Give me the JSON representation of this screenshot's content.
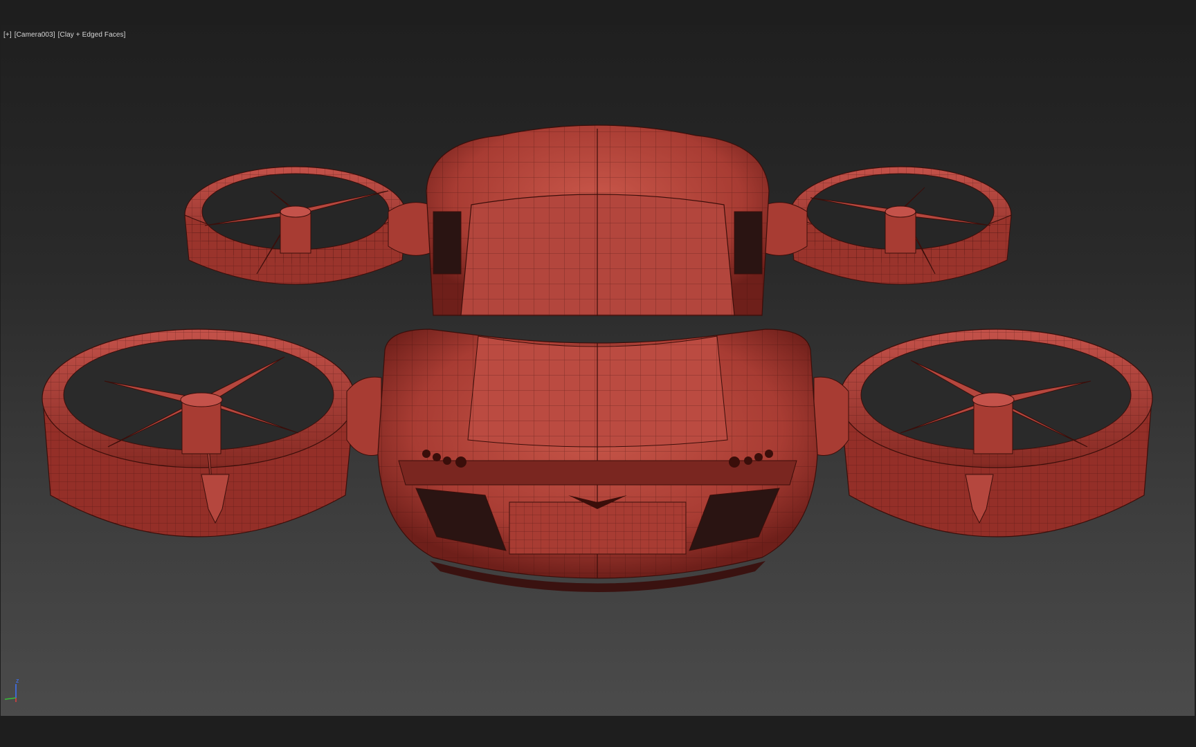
{
  "viewport": {
    "label_plus": "[+]",
    "label_camera": "[Camera003]",
    "label_shading": "[Clay + Edged Faces]"
  },
  "axis": {
    "z_label": "z",
    "colors": {
      "x": "#e04040",
      "y": "#38c038",
      "z": "#3d74ff"
    }
  },
  "model": {
    "color": "#b8463c",
    "wire_color": "#3a0e0a",
    "icon": "flying-car-drone-model"
  }
}
